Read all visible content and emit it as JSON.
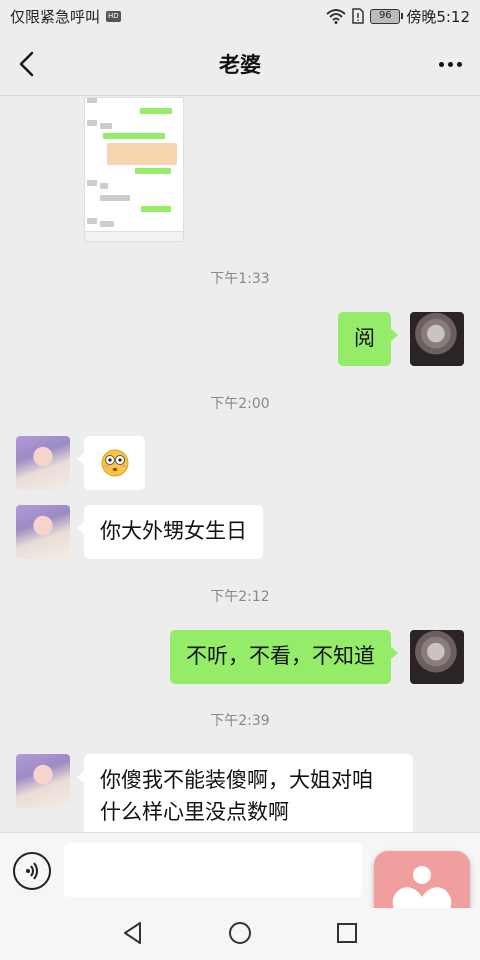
{
  "status_bar": {
    "left_text": "仅限紧急呼叫",
    "battery": "96",
    "time": "傍晚5:12"
  },
  "header": {
    "title": "老婆"
  },
  "messages": [
    {
      "type": "time",
      "text": "下午1:33"
    },
    {
      "type": "out",
      "text": "阅"
    },
    {
      "type": "time",
      "text": "下午2:00"
    },
    {
      "type": "in",
      "emoji": "flushed-face-emoji"
    },
    {
      "type": "in",
      "text": "你大外甥女生日"
    },
    {
      "type": "time",
      "text": "下午2:12"
    },
    {
      "type": "out",
      "text": "不听，不看，不知道"
    },
    {
      "type": "time",
      "text": "下午2:39"
    },
    {
      "type": "in",
      "lines": [
        "你傻我不能装傻啊，大姐对咱",
        "什么样心里没点数啊"
      ]
    }
  ],
  "input": {
    "value": ""
  },
  "icons": {
    "back": "back-arrow-icon",
    "more": "more-dots-icon",
    "voice": "voice-icon",
    "emoji": "emoji-icon",
    "plus": "plus-icon",
    "floating": "heart-app-icon",
    "nav_back": "triangle-back-icon",
    "nav_home": "circle-home-icon",
    "nav_recent": "square-recent-icon"
  },
  "colors": {
    "sent_bubble": "#95ec69",
    "received_bubble": "#ffffff",
    "background": "#ededed",
    "floating_app": "#f19e9e"
  }
}
